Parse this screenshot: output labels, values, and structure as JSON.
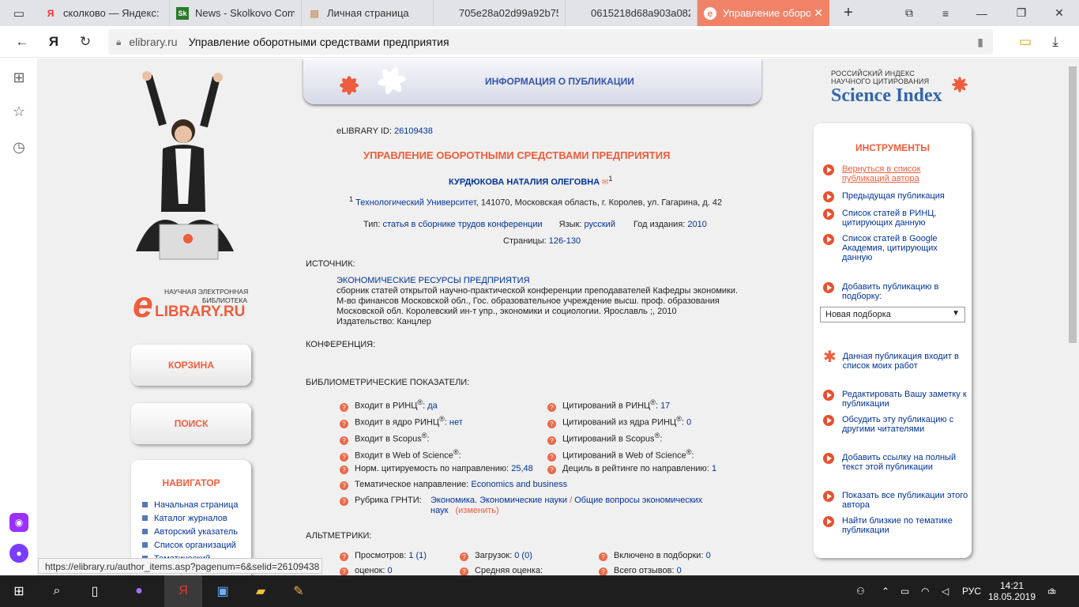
{
  "browser": {
    "tabs": [
      {
        "title": "сколково — Яндекс:",
        "icon": "yandex-icon"
      },
      {
        "title": "News - Skolkovo Com",
        "icon": "skolkovo-icon"
      },
      {
        "title": "Личная страница",
        "icon": "personal-page-icon"
      },
      {
        "title": "705e28a02d99a92b75",
        "icon": "blank-page-icon"
      },
      {
        "title": "0615218d68a903a082",
        "icon": "blank-page-icon"
      },
      {
        "title": "Управление оборо",
        "icon": "elibrary-icon",
        "active": true
      }
    ],
    "url_domain": "elibrary.ru",
    "url_title": "Управление оборотными средствами предприятия",
    "status_url": "https://elibrary.ru/author_items.asp?pagenum=6&selid=26109438"
  },
  "left": {
    "logo_line1": "НАУЧНАЯ ЭЛЕКТРОННАЯ",
    "logo_line2": "БИБЛИОТЕКА",
    "logo_brand": "LIBRARY.RU",
    "logo_e": "e",
    "cart": "КОРЗИНА",
    "search": "ПОИСК",
    "nav_title": "НАВИГАТОР",
    "nav_items": [
      "Начальная страница",
      "Каталог журналов",
      "Авторский указатель",
      "Список организаций",
      "Тематический"
    ]
  },
  "header": {
    "title": "ИНФОРМАЦИЯ О ПУБЛИКАЦИИ"
  },
  "pub": {
    "id_label": "eLIBRARY ID:",
    "id": "26109438",
    "title": "УПРАВЛЕНИЕ ОБОРОТНЫМИ СРЕДСТВАМИ ПРЕДПРИЯТИЯ",
    "author": "КУРДЮКОВА НАТАЛИЯ ОЛЕГОВНА",
    "author_sup": "1",
    "affil_sup": "1",
    "affil_org": "Технологический Университет",
    "affil_rest": ", 141070, Московская область, г. Королев, ул. Гагарина, д. 42",
    "type_label": "Тип:",
    "type": "статья в сборнике трудов конференции",
    "lang_label": "Язык:",
    "lang": "русский",
    "year_label": "Год издания:",
    "year": "2010",
    "pages_label": "Страницы:",
    "pages": "126-130",
    "source_label": "ИСТОЧНИК:",
    "source_name": "ЭКОНОМИЧЕСКИЕ РЕСУРСЫ ПРЕДПРИЯТИЯ",
    "source_l1": "сборник статей открытой научно-практической конференции преподавателей Кафедры экономики.",
    "source_l2": "М-во финансов Московской обл., Гос. образовательное учреждение высш. проф. образования",
    "source_l3": "Московской обл. Королевский ин-т упр., экономики и социологии. Ярославль ;, 2010",
    "publisher_label": "Издательство:",
    "publisher": "Канцлер",
    "conf_label": "КОНФЕРЕНЦИЯ:",
    "biblio_label": "БИБЛИОМЕТРИЧЕСКИЕ ПОКАЗАТЕЛИ:",
    "rinc_label": "Входит в РИНЦ",
    "rinc": "да",
    "core_label": "Входит в ядро РИНЦ",
    "core": "нет",
    "scopus_label": "Входит в Scopus",
    "wos_label": "Входит в Web of Science",
    "norm_label": "Норм. цитируемость по направлению:",
    "norm": "25,48",
    "theme_label": "Тематическое направление:",
    "theme": "Economics and business",
    "grnti_label": "Рубрика ГРНТИ:",
    "grnti_a": "Экономика. Экономические науки",
    "grnti_sep": "/",
    "grnti_b1": "Общие вопросы экономических",
    "grnti_b2": "наук",
    "grnti_edit": "изменить",
    "cit_rinc_label": "Цитирований в РИНЦ",
    "cit_rinc": "17",
    "cit_core_label": "Цитирований из ядра РИНЦ",
    "cit_core": "0",
    "cit_scopus_label": "Цитирований в Scopus",
    "cit_wos_label": "Цитирований в Web of Science",
    "decile_label": "Дециль в рейтинге по направлению:",
    "decile": "1",
    "reg": "®",
    "colon": ":",
    "alt_label": "АЛЬТМЕТРИКИ:",
    "views_label": "Просмотров:",
    "views": "1 (1)",
    "downloads_label": "Загрузок:",
    "downloads": "0 (0)",
    "collections_label": "Включено в подборки:",
    "collections": "0",
    "ratings_label": "оценок:",
    "ratings": "0",
    "avg_label": "Средняя оценка:",
    "reviews_label": "Всего отзывов:",
    "reviews": "0"
  },
  "science_index": {
    "line1": "РОССИЙСКИЙ ИНДЕКС",
    "line2": "НАУЧНОГО ЦИТИРОВАНИЯ",
    "brand": "Science Index"
  },
  "tools": {
    "title": "ИНСТРУМЕНТЫ",
    "items": [
      "Вернуться в список публикаций автора",
      "Предыдущая публикация",
      "Список статей в РИНЦ, цитирующих данную",
      "Список статей в Google Академия, цитирующих данную",
      "Добавить публикацию в подборку:",
      "Данная публикация входит в список моих работ",
      "Редактировать Вашу заметку к публикации",
      "Обсудить эту публикацию с другими читателями",
      "Добавить ссылку на полный текст этой публикации",
      "Показать все публикации этого автора",
      "Найти близкие по тематике публикации"
    ],
    "select_value": "Новая подборка"
  },
  "taskbar": {
    "lang": "РУС",
    "time": "14:21",
    "date": "18.05.2019",
    "notif": "3"
  }
}
